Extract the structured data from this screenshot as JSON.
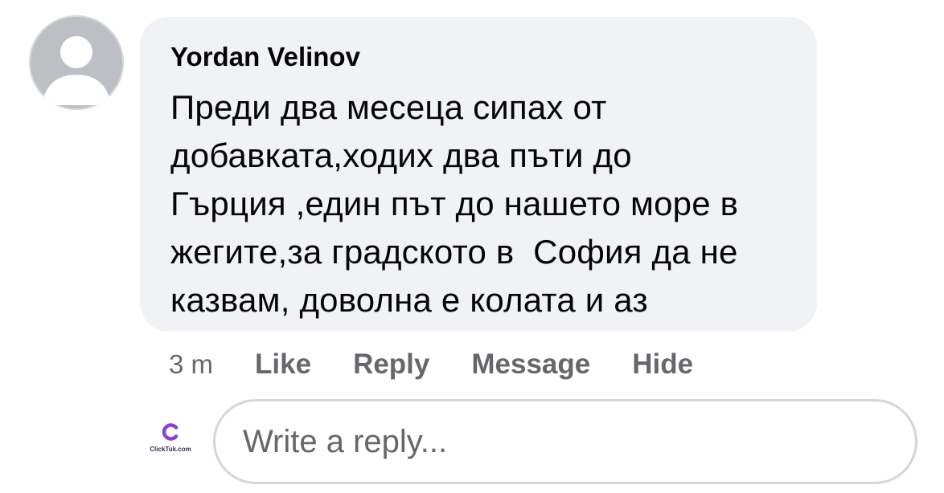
{
  "comment": {
    "author": "Yordan Velinov",
    "lines": [
      "Преди два месеца сипах от",
      "добавката,ходих два пъти до",
      "Гърция ,един път до нашето море в",
      "жегите,за градското в  София да не",
      "казвам, доволна е колата и аз"
    ]
  },
  "actions": {
    "time": "3 m",
    "like": "Like",
    "reply": "Reply",
    "message": "Message",
    "hide": "Hide"
  },
  "reply_input": {
    "placeholder": "Write a reply..."
  },
  "watermark": {
    "letter": "C",
    "text": "ClickTuk.com"
  },
  "icons": {
    "avatar": "default-profile-silhouette-icon",
    "logo": "clicktuk-c-logo-icon"
  },
  "colors": {
    "bubble": "#f0f2f5",
    "text": "#050505",
    "secondary": "#65676b",
    "avatar_bg": "#bcc0c4",
    "logo_purple": "#8b3fd9"
  }
}
